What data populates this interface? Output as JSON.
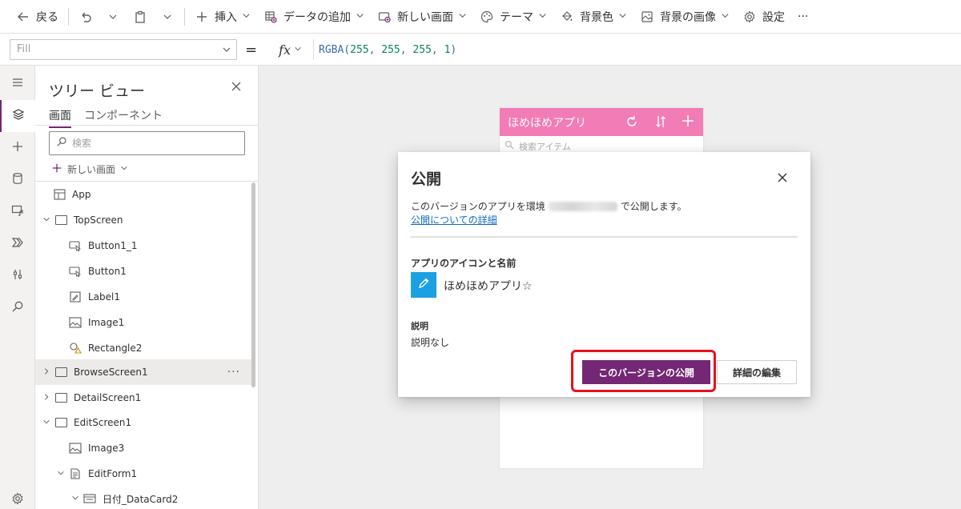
{
  "toolbar": {
    "back": "戻る",
    "insert": "挿入",
    "add_data": "データの追加",
    "new_screen": "新しい画面",
    "theme": "テーマ",
    "bg_color": "背景色",
    "bg_image": "背景の画像",
    "settings": "設定",
    "more": "···"
  },
  "formula_bar": {
    "property": "Fill",
    "equals": "=",
    "fx": "fx",
    "formula_prefix": "RGBA(",
    "r": "255",
    "g": "255",
    "b": "255",
    "a": "1",
    "formula_suffix": ")"
  },
  "tree": {
    "title": "ツリー ビュー",
    "tabs": [
      "画面",
      "コンポーネント"
    ],
    "search_placeholder": "検索",
    "new_screen": "新しい画面",
    "nodes": [
      "App",
      "TopScreen",
      "Button1_1",
      "Button1",
      "Label1",
      "Image1",
      "Rectangle2",
      "BrowseScreen1",
      "DetailScreen1",
      "EditScreen1",
      "Image3",
      "EditForm1",
      "日付_DataCard2"
    ],
    "node_more": "···"
  },
  "phone": {
    "app_title": "ほめほめアプリ",
    "search_placeholder": "検索アイテム"
  },
  "dialog": {
    "title": "公開",
    "text_before": "このバージョンのアプリを環境",
    "text_after": "で公開します。",
    "link": "公開についての詳細",
    "icon_name_heading": "アプリのアイコンと名前",
    "app_name": "ほめほめアプリ☆",
    "description_heading": "説明",
    "description": "説明なし",
    "publish_button": "このバージョンの公開",
    "edit_button": "詳細の編集"
  },
  "colors": {
    "accent": "#742774",
    "header_pink": "#f065a8",
    "highlight_red": "#e8101b",
    "app_icon_blue": "#1ba1e2",
    "link_blue": "#0f6cbd"
  }
}
